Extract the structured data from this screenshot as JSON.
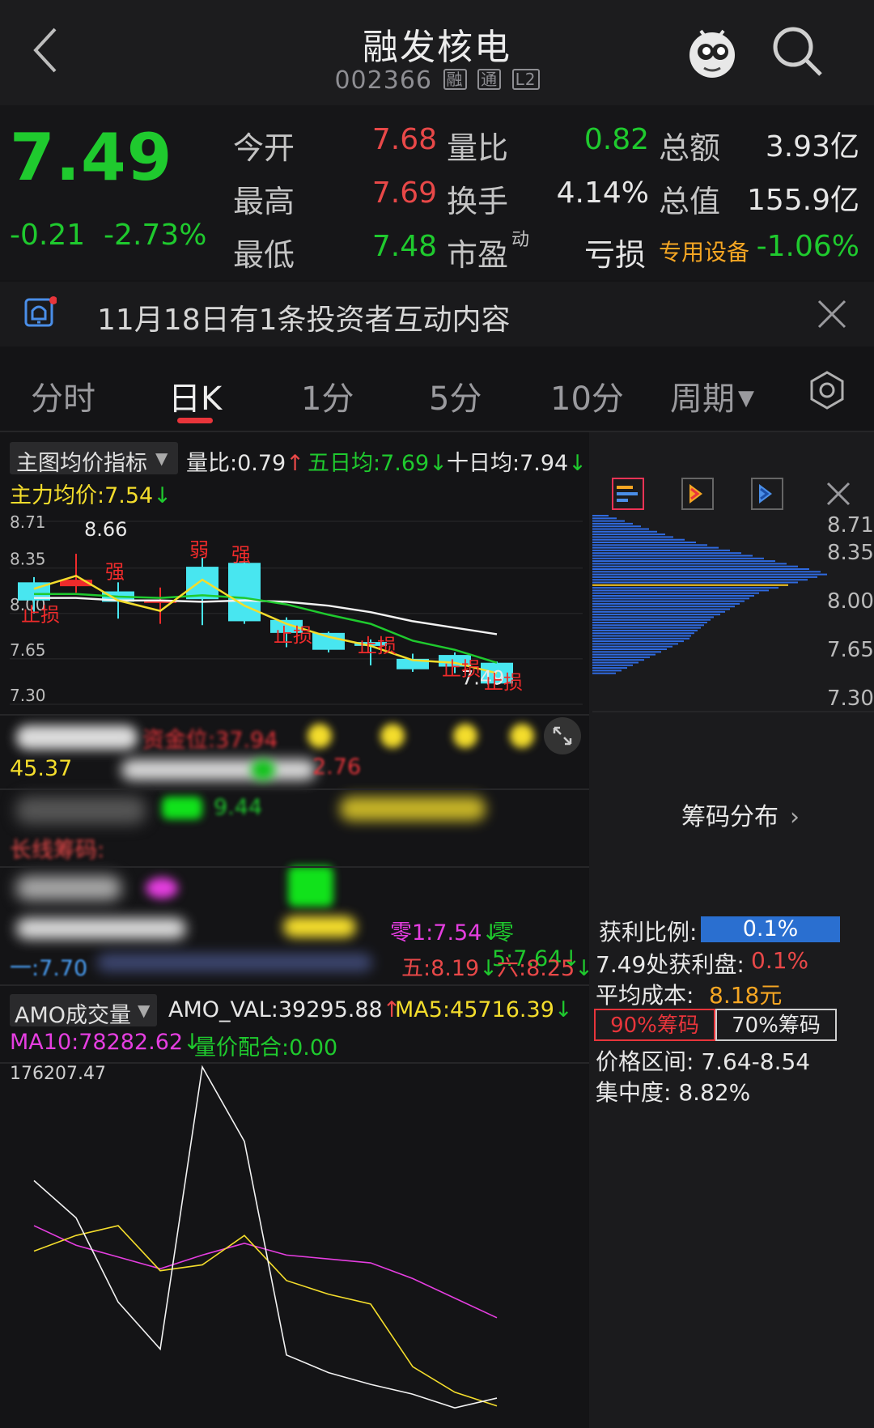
{
  "header": {
    "title": "融发核电",
    "code": "002366",
    "tags": [
      "融",
      "通",
      "L2"
    ]
  },
  "quote": {
    "price": "7.49",
    "change": "-0.21",
    "change_pct": "-2.73%",
    "rows": [
      {
        "l1": "今开",
        "v1": "7.68",
        "l2": "量比",
        "v2": "0.82",
        "l3": "总额",
        "v3": "3.93亿"
      },
      {
        "l1": "最高",
        "v1": "7.69",
        "l2": "换手",
        "v2": "4.14%",
        "l3": "总值",
        "v3": "155.9亿"
      },
      {
        "l1": "最低",
        "v1": "7.48",
        "l2": "市盈",
        "l2_sup": "动",
        "l3": "亏损",
        "sector": "专用设备",
        "sector_pct": "-1.06%"
      }
    ]
  },
  "notice": {
    "text": "11月18日有1条投资者互动内容"
  },
  "tabs": [
    {
      "label": "分时"
    },
    {
      "label": "日K"
    },
    {
      "label": "1分"
    },
    {
      "label": "5分"
    },
    {
      "label": "10分"
    },
    {
      "label": "周期"
    }
  ],
  "main_chart": {
    "indicator_selector": "主图均价指标",
    "liangbi": "量比:0.79",
    "wuri": "五日均:7.69",
    "shiri": "十日均:7.94",
    "zhuli": "主力均价:7.54",
    "y_ticks": [
      "8.71",
      "8.35",
      "8.00",
      "7.65",
      "7.30"
    ],
    "high_label": "8.66",
    "last_label": "7.49",
    "annotations": [
      {
        "text": "止损"
      },
      {
        "text": "强"
      },
      {
        "text": "弱"
      },
      {
        "text": "强"
      },
      {
        "text": "止损"
      },
      {
        "text": "止损"
      },
      {
        "text": "止损"
      },
      {
        "text": "止损"
      }
    ]
  },
  "chart_data": {
    "type": "line",
    "title": "",
    "candles": {
      "open": [
        8.24,
        8.21,
        8.17,
        8.1,
        8.36,
        8.39,
        7.95,
        7.85,
        7.78,
        7.65,
        7.68,
        7.62
      ],
      "close": [
        8.1,
        8.26,
        8.09,
        8.1,
        8.11,
        7.94,
        7.85,
        7.72,
        7.75,
        7.57,
        7.59,
        7.46
      ],
      "high": [
        8.28,
        8.46,
        8.24,
        8.2,
        8.43,
        8.4,
        7.97,
        7.86,
        7.8,
        7.69,
        7.7,
        7.63
      ],
      "low": [
        8.0,
        8.16,
        7.96,
        7.92,
        7.91,
        7.92,
        7.74,
        7.7,
        7.6,
        7.55,
        7.54,
        7.45
      ],
      "main_avg": [
        8.19,
        8.29,
        8.1,
        8.02,
        8.26,
        8.06,
        7.92,
        7.82,
        7.75,
        7.64,
        7.62,
        7.54
      ],
      "ma5": [
        8.15,
        8.15,
        8.13,
        8.12,
        8.14,
        8.12,
        8.07,
        7.99,
        7.92,
        7.79,
        7.72,
        7.62
      ],
      "ma10": [
        8.12,
        8.12,
        8.1,
        8.1,
        8.09,
        8.1,
        8.09,
        8.06,
        8.01,
        7.94,
        7.89,
        7.84
      ],
      "ylim": [
        7.3,
        8.71
      ]
    }
  },
  "chip": {
    "profit_ratio_label": "获利比例:",
    "profit_ratio": "0.1%",
    "profit_at_label": "7.49处获利盘:",
    "profit_at": "0.1%",
    "avg_cost_label": "平均成本:",
    "avg_cost": "8.18元",
    "btn90": "90%筹码",
    "btn70": "70%筹码",
    "range": "价格区间: 7.64-8.54",
    "concentration": "集中度: 8.82%",
    "title": "筹码分布",
    "y_ticks": [
      "8.71",
      "8.35",
      "8.00",
      "7.65",
      "7.30"
    ]
  },
  "obscured": {
    "zijin": "资金位:37.94",
    "v45": "45.37",
    "v276": "2.76",
    "v944": "9.44",
    "changxian": "长线筹码:",
    "ling1": "零1:7.54",
    "ling5": "零5:7.64",
    "yi": "一:7.70",
    "wu": "五:8.19",
    "liu": "六:8.25"
  },
  "volume": {
    "selector": "AMO成交量",
    "amo_val": "AMO_VAL:39295.88",
    "ma5": "MA5:45716.39",
    "ma10": "MA10:78282.62",
    "lj": "量价配合:0.00",
    "max": "176207.47",
    "amo_series": [
      118000,
      99000,
      56000,
      32000,
      176000,
      138000,
      29000,
      20000,
      14000,
      9000,
      2000,
      7000
    ],
    "ma5_series": [
      82000,
      90000,
      95000,
      72000,
      75000,
      90000,
      67000,
      60000,
      55000,
      23000,
      10000,
      3000
    ],
    "ma10_series": [
      95000,
      85000,
      79000,
      73000,
      80000,
      86000,
      80000,
      78000,
      76000,
      68000,
      58000,
      48000
    ]
  },
  "colors": {
    "up": "#e84848",
    "down": "#1fca2e",
    "accent": "#e8353b",
    "bg": "#141416"
  }
}
